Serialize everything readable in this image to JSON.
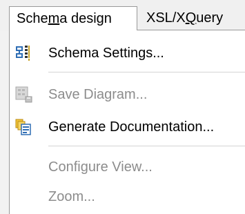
{
  "menubar": {
    "tabs": [
      {
        "label_pre": "Sche",
        "label_accel": "m",
        "label_post": "a design",
        "active": true
      },
      {
        "label_pre": "XSL/X",
        "label_accel": "Q",
        "label_post": "uery",
        "active": false
      }
    ]
  },
  "menu": {
    "items": [
      {
        "label": "Schema Settings...",
        "icon": "schema-settings-icon",
        "enabled": true
      },
      {
        "label": "Save Diagram...",
        "icon": "save-diagram-icon",
        "enabled": false
      },
      {
        "label": "Generate Documentation...",
        "icon": "generate-documentation-icon",
        "enabled": true
      },
      {
        "label": "Configure View...",
        "icon": null,
        "enabled": false
      },
      {
        "label": "Zoom...",
        "icon": null,
        "enabled": false
      }
    ]
  },
  "colors": {
    "enabled_text": "#000000",
    "disabled_text": "#8c8c8c",
    "border": "#999999",
    "separator": "#d4d4d4"
  }
}
